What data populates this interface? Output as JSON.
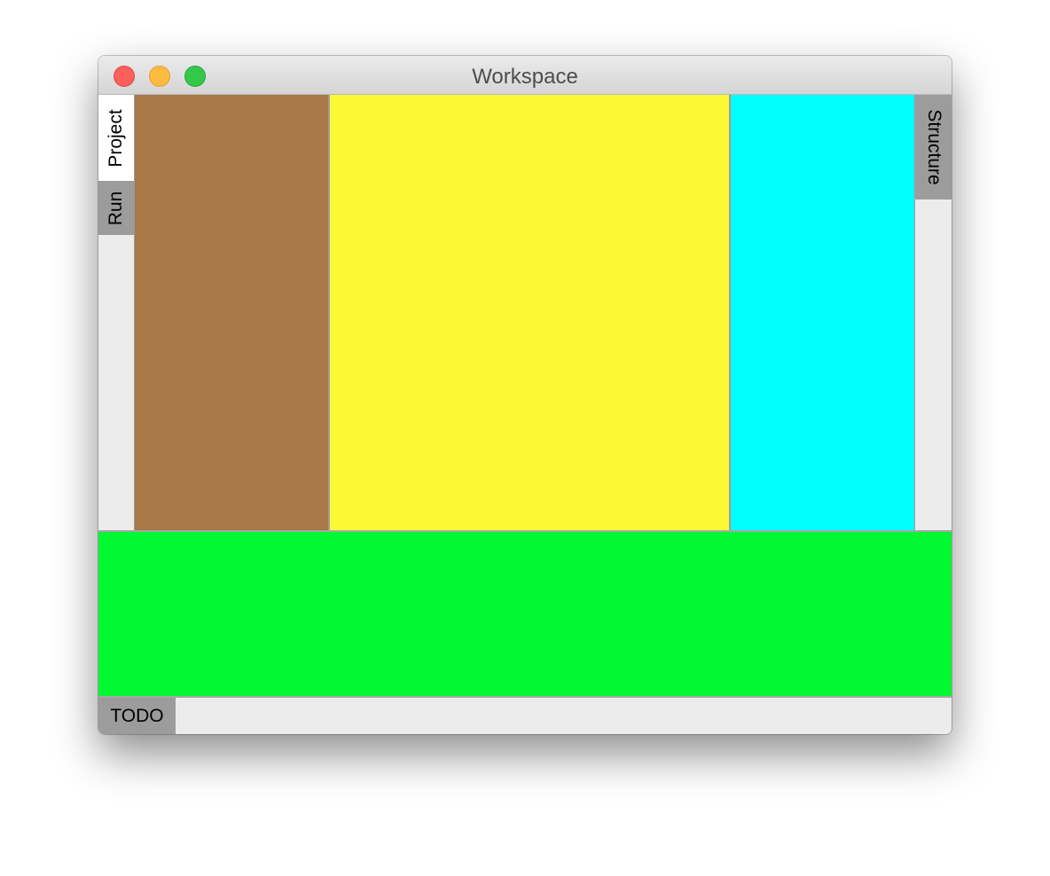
{
  "window": {
    "title": "Workspace"
  },
  "left_tabs": [
    {
      "label": "Project",
      "selected": true
    },
    {
      "label": "Run",
      "selected": false
    }
  ],
  "right_tabs": [
    {
      "label": "Structure",
      "selected": false
    }
  ],
  "bottom_tabs": [
    {
      "label": "TODO",
      "selected": false
    }
  ],
  "panels": {
    "left_panel_color": "#a87847",
    "editor_panel_color": "#fcf833",
    "right_panel_color": "#00ffff",
    "bottom_panel_color": "#00f932"
  },
  "colors": {
    "close": "#fc605c",
    "minimize": "#fdbc40",
    "zoom": "#34c84a",
    "tab_inactive": "#9c9c9c",
    "tab_selected": "#ffffff"
  }
}
